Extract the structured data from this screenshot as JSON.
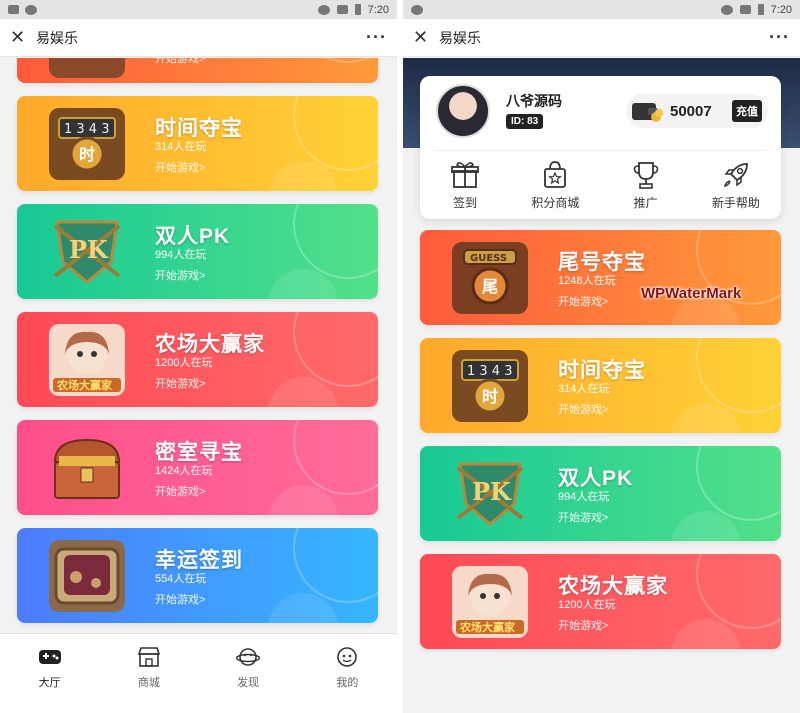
{
  "status_time": "7:20",
  "app_title": "易娱乐",
  "left": {
    "games": [
      {
        "name": "时间夺宝",
        "players": "314人在玩",
        "start": "开始游戏>",
        "gradient": "yellow",
        "icon": "time-treasure-icon"
      },
      {
        "name": "双人PK",
        "players": "994人在玩",
        "start": "开始游戏>",
        "gradient": "green",
        "icon": "pk-shield-icon"
      },
      {
        "name": "农场大赢家",
        "players": "1200人在玩",
        "start": "开始游戏>",
        "gradient": "red",
        "icon": "farm-girl-icon"
      },
      {
        "name": "密室寻宝",
        "players": "1424人在玩",
        "start": "开始游戏>",
        "gradient": "pink",
        "icon": "treasure-chest-icon"
      },
      {
        "name": "幸运签到",
        "players": "554人在玩",
        "start": "开始游戏>",
        "gradient": "blue",
        "icon": "lucky-checkin-icon"
      }
    ],
    "nav": [
      {
        "label": "大厅",
        "icon": "gamepad-icon",
        "active": true
      },
      {
        "label": "商城",
        "icon": "shop-icon",
        "active": false
      },
      {
        "label": "发现",
        "icon": "planet-icon",
        "active": false
      },
      {
        "label": "我的",
        "icon": "face-icon",
        "active": false
      }
    ]
  },
  "right": {
    "profile": {
      "username": "八爷源码",
      "user_id": "ID: 83",
      "coins": "50007",
      "recharge_label": "充值"
    },
    "actions": [
      {
        "label": "签到",
        "icon": "gift-icon"
      },
      {
        "label": "积分商城",
        "icon": "bag-star-icon"
      },
      {
        "label": "推广",
        "icon": "trophy-icon"
      },
      {
        "label": "新手帮助",
        "icon": "rocket-icon"
      }
    ],
    "games": [
      {
        "name": "尾号夺宝",
        "players": "1248人在玩",
        "start": "开始游戏>",
        "gradient": "orange",
        "icon": "guess-icon"
      },
      {
        "name": "时间夺宝",
        "players": "314人在玩",
        "start": "开始游戏>",
        "gradient": "yellow",
        "icon": "time-treasure-icon"
      },
      {
        "name": "双人PK",
        "players": "994人在玩",
        "start": "开始游戏>",
        "gradient": "green",
        "icon": "pk-shield-icon"
      },
      {
        "name": "农场大赢家",
        "players": "1200人在玩",
        "start": "开始游戏>",
        "gradient": "red",
        "icon": "farm-girl-icon"
      }
    ],
    "watermark": "WPWaterMark"
  }
}
